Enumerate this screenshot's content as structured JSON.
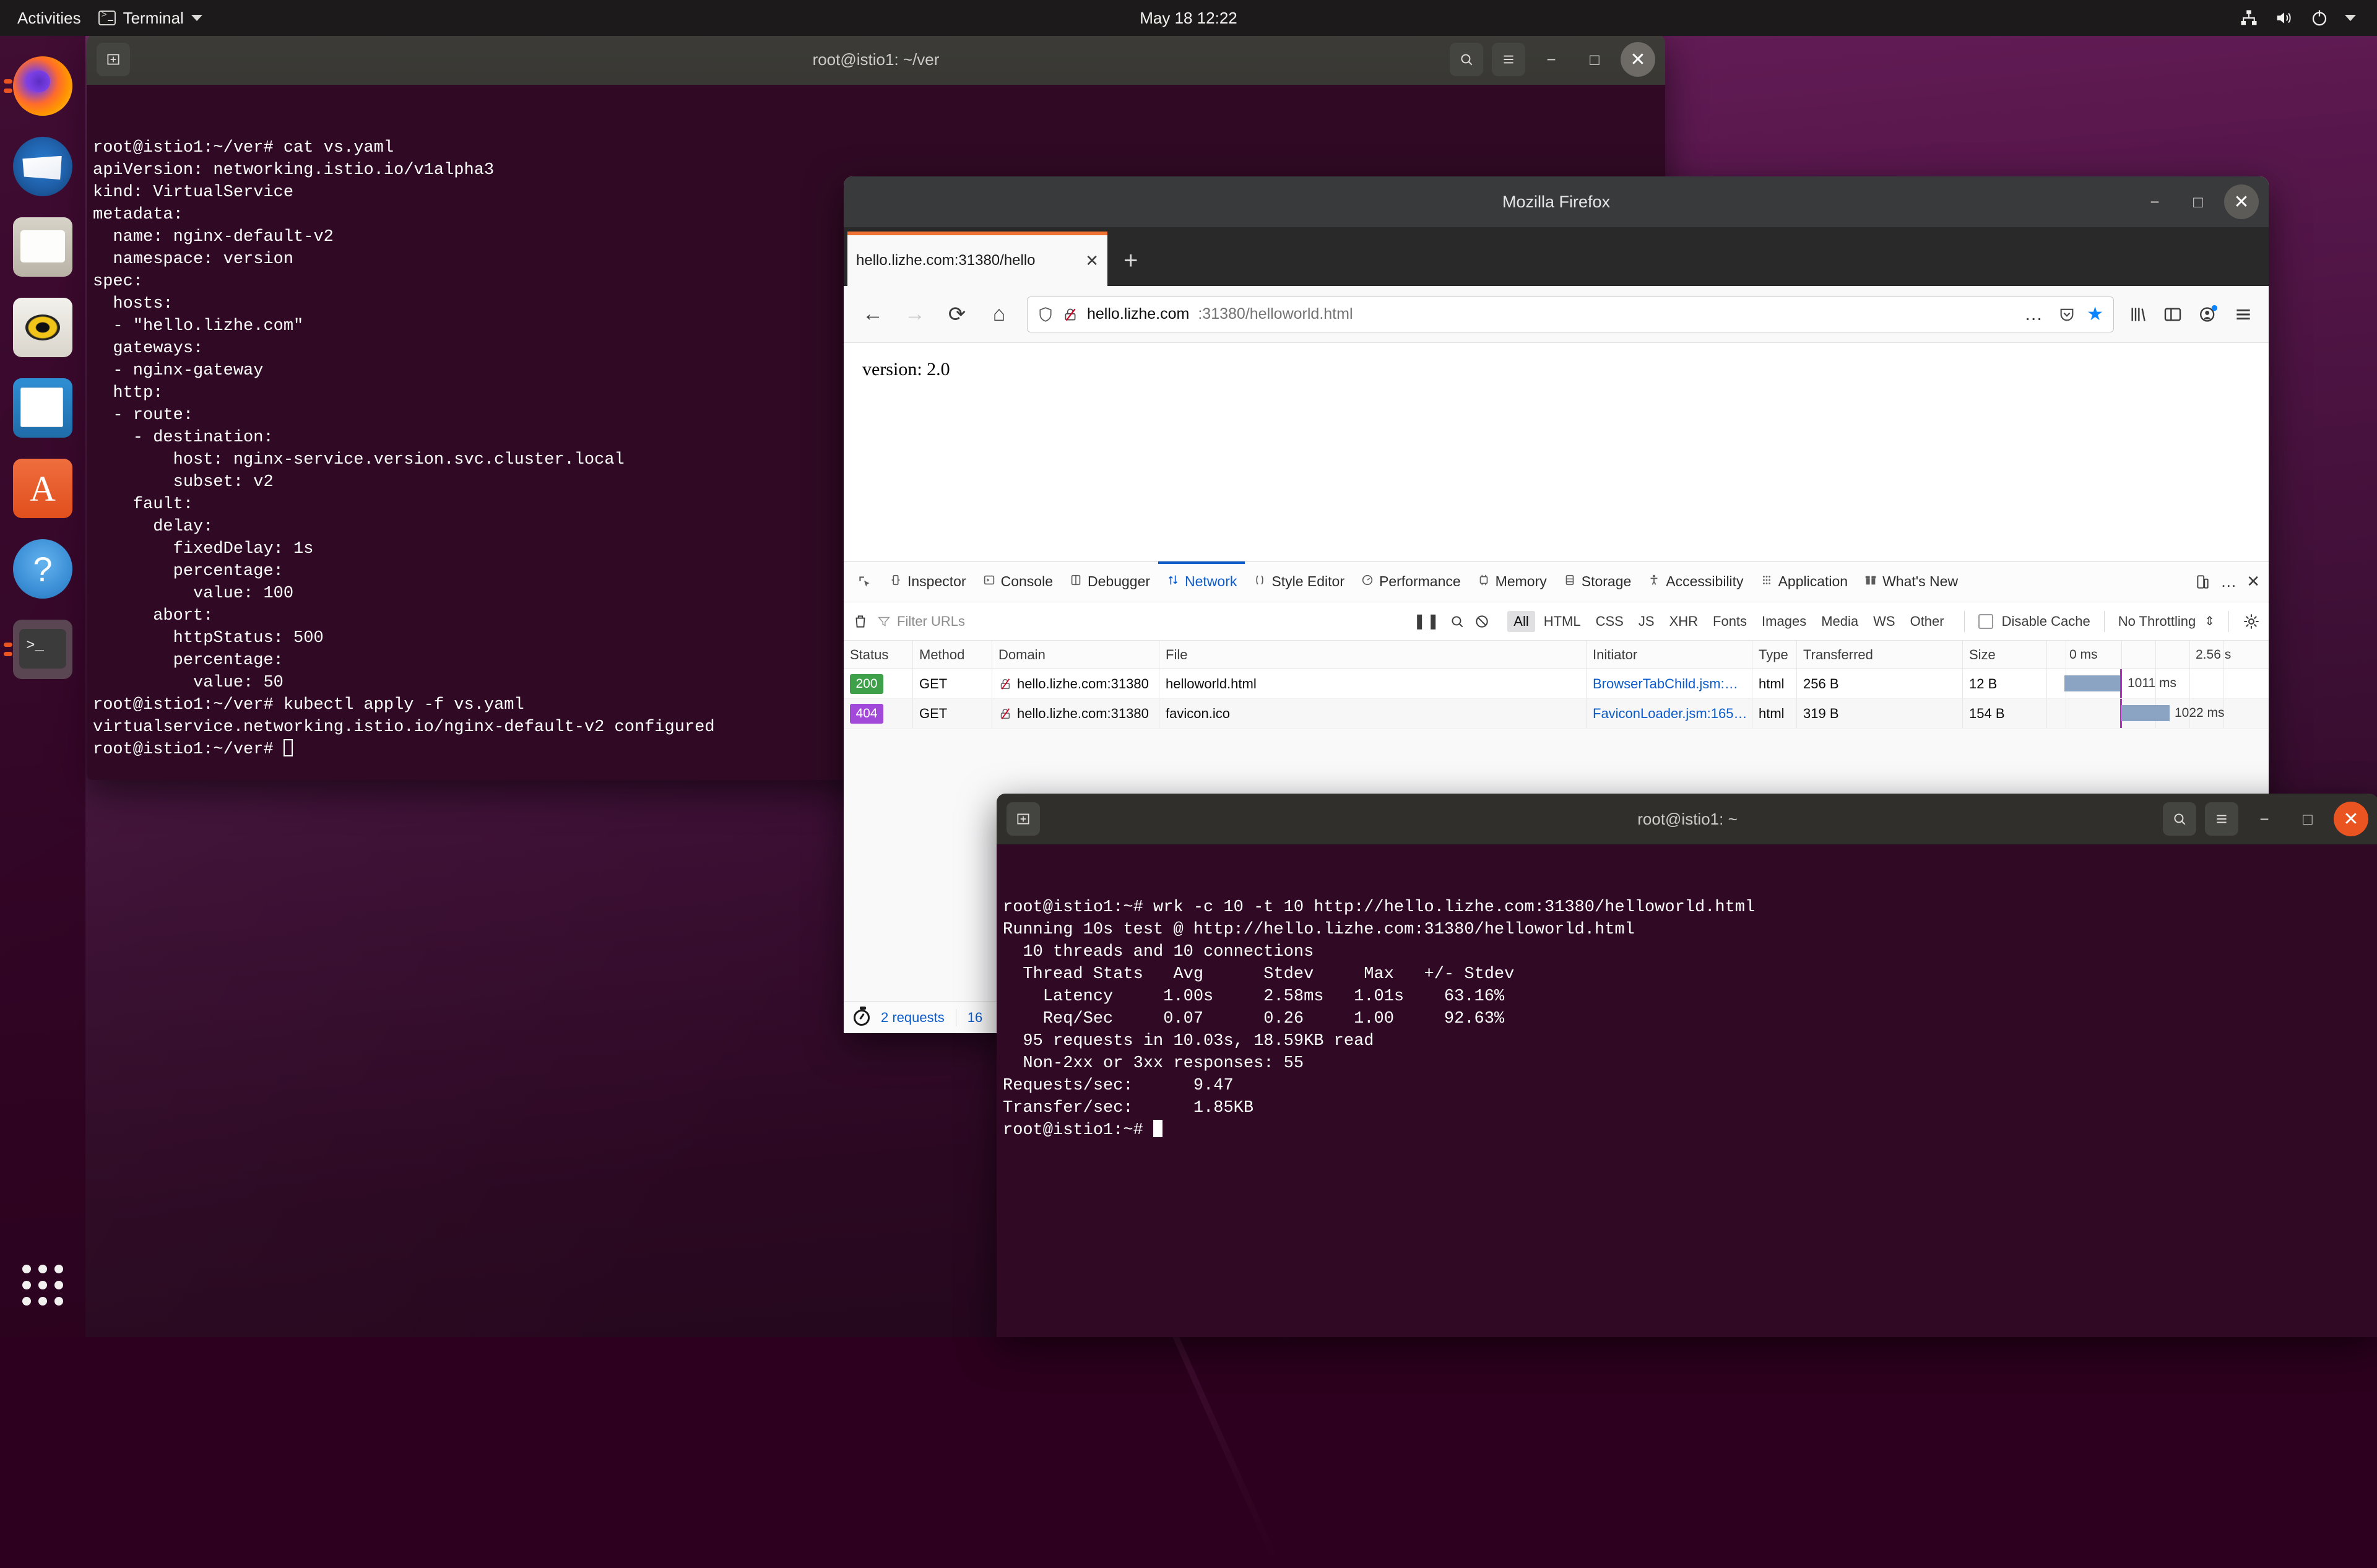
{
  "topbar": {
    "activities": "Activities",
    "app_menu": "Terminal",
    "clock": "May 18  12:22",
    "tray_icons": [
      "network-icon",
      "volume-icon",
      "power-icon",
      "chevron-down-icon"
    ]
  },
  "dock": {
    "items": [
      {
        "name": "firefox",
        "label": "Firefox",
        "running": true
      },
      {
        "name": "thunderbird",
        "label": "Thunderbird",
        "running": false
      },
      {
        "name": "files",
        "label": "Files",
        "running": false
      },
      {
        "name": "rhythmbox",
        "label": "Rhythmbox",
        "running": false
      },
      {
        "name": "libreoffice-writer",
        "label": "LibreOffice Writer",
        "running": false
      },
      {
        "name": "ubuntu-software",
        "label": "Ubuntu Software",
        "running": false
      },
      {
        "name": "help",
        "label": "Help",
        "running": false
      },
      {
        "name": "terminal",
        "label": "Terminal",
        "running": true
      }
    ],
    "show_apps_label": "Show Applications"
  },
  "terminal1": {
    "title": "root@istio1: ~/ver",
    "new_tab_label": "+",
    "controls": {
      "search": "search-icon",
      "menu": "hamburger-icon",
      "minimize": "−",
      "maximize": "□",
      "close": "✕"
    },
    "lines": [
      "root@istio1:~/ver# cat vs.yaml",
      "apiVersion: networking.istio.io/v1alpha3",
      "kind: VirtualService",
      "metadata:",
      "  name: nginx-default-v2",
      "  namespace: version",
      "spec:",
      "  hosts:",
      "  - \"hello.lizhe.com\"",
      "  gateways:",
      "  - nginx-gateway",
      "  http:",
      "  - route:",
      "    - destination:",
      "        host: nginx-service.version.svc.cluster.local",
      "        subset: v2",
      "    fault:",
      "      delay:",
      "        fixedDelay: 1s",
      "        percentage:",
      "          value: 100",
      "      abort:",
      "        httpStatus: 500",
      "        percentage:",
      "          value: 50",
      "",
      "root@istio1:~/ver# kubectl apply -f vs.yaml",
      "virtualservice.networking.istio.io/nginx-default-v2 configured",
      "root@istio1:~/ver# "
    ]
  },
  "terminal2": {
    "title": "root@istio1: ~",
    "controls": {
      "search": "search-icon",
      "menu": "hamburger-icon",
      "minimize": "−",
      "maximize": "□",
      "close": "✕"
    },
    "lines": [
      "root@istio1:~# wrk -c 10 -t 10 http://hello.lizhe.com:31380/helloworld.html",
      "Running 10s test @ http://hello.lizhe.com:31380/helloworld.html",
      "  10 threads and 10 connections",
      "  Thread Stats   Avg      Stdev     Max   +/- Stdev",
      "    Latency     1.00s     2.58ms   1.01s    63.16%",
      "    Req/Sec     0.07      0.26     1.00     92.63%",
      "  95 requests in 10.03s, 18.59KB read",
      "  Non-2xx or 3xx responses: 55",
      "Requests/sec:      9.47",
      "Transfer/sec:      1.85KB",
      "root@istio1:~# "
    ]
  },
  "firefox": {
    "window_title": "Mozilla Firefox",
    "window_controls": {
      "minimize": "−",
      "maximize": "□",
      "close": "✕"
    },
    "tab": {
      "label": "hello.lizhe.com:31380/hello",
      "close": "✕"
    },
    "new_tab": "+",
    "nav": {
      "back": "←",
      "forward": "→",
      "reload": "⟳",
      "home": "⌂"
    },
    "urlbar": {
      "host": "hello.lizhe.com",
      "rest": ":31380/helloworld.html",
      "full_url": "hello.lizhe.com:31380/helloworld.html",
      "shield_icon": "shield-icon",
      "connection_icon": "broken-lock-icon",
      "page_actions": "…",
      "pocket_icon": "pocket-icon",
      "bookmark_icon": "star-icon"
    },
    "toolbar_right": [
      "library-icon",
      "sidebar-icon",
      "account-icon",
      "menu-icon"
    ],
    "page_content": "version: 2.0"
  },
  "devtools": {
    "tabs": [
      {
        "label": "Inspector",
        "icon": "inspector-icon",
        "active": false
      },
      {
        "label": "Console",
        "icon": "console-icon",
        "active": false
      },
      {
        "label": "Debugger",
        "icon": "debugger-icon",
        "active": false
      },
      {
        "label": "Network",
        "icon": "network-icon",
        "active": true
      },
      {
        "label": "Style Editor",
        "icon": "style-editor-icon",
        "active": false
      },
      {
        "label": "Performance",
        "icon": "performance-icon",
        "active": false
      },
      {
        "label": "Memory",
        "icon": "memory-icon",
        "active": false
      },
      {
        "label": "Storage",
        "icon": "storage-icon",
        "active": false
      },
      {
        "label": "Accessibility",
        "icon": "accessibility-icon",
        "active": false
      },
      {
        "label": "Application",
        "icon": "application-icon",
        "active": false
      },
      {
        "label": "What's New",
        "icon": "whats-new-icon",
        "active": false
      }
    ],
    "picker_icon": "element-picker-icon",
    "tab_right_icons": [
      "responsive-design-icon",
      "meatball-menu-icon",
      "close-icon"
    ],
    "toolbar": {
      "trash_icon": "trash-icon",
      "filter_placeholder": "Filter URLs",
      "pause_icon": "pause-icon",
      "search_icon": "search-icon",
      "block_icon": "block-icon",
      "filters": [
        "All",
        "HTML",
        "CSS",
        "JS",
        "XHR",
        "Fonts",
        "Images",
        "Media",
        "WS",
        "Other"
      ],
      "active_filter": "All",
      "disable_cache_label": "Disable Cache",
      "disable_cache_checked": false,
      "throttling_label": "No Throttling",
      "settings_icon": "gear-icon"
    },
    "table": {
      "columns": [
        "Status",
        "Method",
        "Domain",
        "File",
        "Initiator",
        "Type",
        "Transferred",
        "Size"
      ],
      "timeline_ticks": [
        "0 ms",
        "2.56 s"
      ],
      "rows": [
        {
          "status": "200",
          "status_kind": "ok",
          "method": "GET",
          "domain": "hello.lizhe.com:31380",
          "file": "helloworld.html",
          "initiator": "BrowserTabChild.jsm:…",
          "type": "html",
          "transferred": "256 B",
          "size": "12 B",
          "time": "1011 ms"
        },
        {
          "status": "404",
          "status_kind": "error",
          "method": "GET",
          "domain": "hello.lizhe.com:31380",
          "file": "favicon.ico",
          "initiator": "FaviconLoader.jsm:165…",
          "type": "html",
          "transferred": "319 B",
          "size": "154 B",
          "time": "1022 ms"
        }
      ]
    },
    "status": {
      "requests": "2 requests",
      "transferred_partial": "16"
    }
  },
  "colors": {
    "ubuntu_purple": "#2c001e",
    "accent_orange": "#e95420",
    "devtools_accent": "#0b5bcb",
    "status_ok": "#3fa04a",
    "status_error": "#a349d9",
    "timeline_bar": "#8ba4c4",
    "timeline_marker": "#b52ec1"
  }
}
